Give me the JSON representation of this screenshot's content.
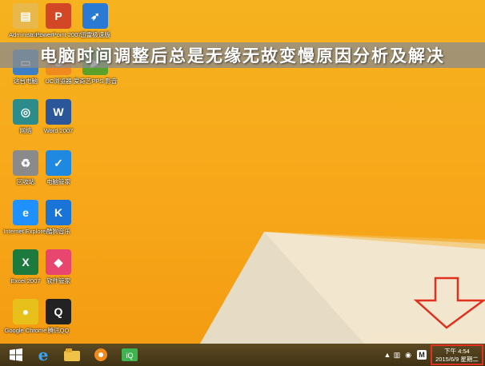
{
  "banner": {
    "title": "电脑时间调整后总是无缘无故变慢原因分析及解决"
  },
  "desktop_icons": [
    {
      "label": "Administra...",
      "icon": "folder-icon",
      "color": "#e9b84a"
    },
    {
      "label": "PowerPoint 2007",
      "icon": "powerpoint-icon",
      "color": "#d24726"
    },
    {
      "label": "迅雷极速版",
      "icon": "bird-icon",
      "color": "#2a7ad4"
    },
    {
      "label": "这台电脑",
      "icon": "computer-icon",
      "color": "#3d7fc4"
    },
    {
      "label": "UC浏览器",
      "icon": "uc-browser-icon",
      "color": "#f08a1f"
    },
    {
      "label": "爱奇艺PPS 影音",
      "icon": "video-player-icon",
      "color": "#5aa02c"
    },
    {
      "label": "网络",
      "icon": "network-icon",
      "color": "#2c8c8c"
    },
    {
      "label": "Word 2007",
      "icon": "word-icon",
      "color": "#2b579a"
    },
    {
      "label": "回收站",
      "icon": "recycle-bin-icon",
      "color": "#8a8a8a"
    },
    {
      "label": "电脑管家",
      "icon": "shield-icon",
      "color": "#1f88e0"
    },
    {
      "label": "Internet Explorer",
      "icon": "ie-icon",
      "color": "#1e90ff"
    },
    {
      "label": "酷狗音乐",
      "icon": "kugou-icon",
      "color": "#1a74d8"
    },
    {
      "label": "Excel 2007",
      "icon": "excel-icon",
      "color": "#1d7a3e"
    },
    {
      "label": "软件管家",
      "icon": "software-manager-icon",
      "color": "#e8456f"
    },
    {
      "label": "Google Chrome",
      "icon": "chrome-icon",
      "color": "#e8c01c"
    },
    {
      "label": "腾讯QQ",
      "icon": "qq-icon",
      "color": "#222222"
    }
  ],
  "taskbar": {
    "pinned": [
      "windows-start-icon",
      "ie-icon",
      "file-explorer-icon",
      "uc-browser-icon",
      "iqiyi-icon"
    ],
    "tray": {
      "badge": "M",
      "time": "下午 4:54",
      "date": "2015/6/9 星期二"
    }
  }
}
